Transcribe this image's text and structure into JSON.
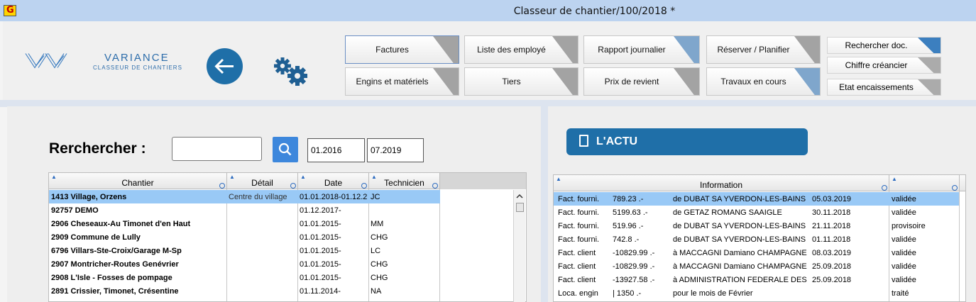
{
  "window": {
    "title": "Classeur de chantier/100/2018 *",
    "app_icon_letter": "G"
  },
  "logo": {
    "name": "VARIANCE",
    "subtitle": "CLASSEUR DE CHANTIERS"
  },
  "nav": {
    "row1": [
      "Factures",
      "Liste des employé",
      "Rapport journalier",
      "Réserver / Planifier"
    ],
    "row2": [
      "Engins et matériels",
      "Tiers",
      "Prix de revient",
      "Travaux en cours"
    ],
    "side": [
      "Rechercher doc.",
      "Chiffre créancier",
      "Etat encaissements"
    ]
  },
  "search": {
    "label": "Rerchercher :",
    "value": "",
    "date_from": "01.2016",
    "date_to": "07.2019"
  },
  "chantier_table": {
    "columns": [
      "Chantier",
      "Détail",
      "Date",
      "Technicien"
    ],
    "rows": [
      [
        "1413 Village, Orzens",
        "Centre du village",
        "01.01.2018-01.12.2",
        "JC"
      ],
      [
        "92757 DEMO",
        "",
        "01.12.2017-",
        ""
      ],
      [
        "2906 Cheseaux-Au Timonet d'en Haut",
        "",
        "01.01.2015-",
        "MM"
      ],
      [
        "2909 Commune de Lully",
        "",
        "01.01.2015-",
        "CHG"
      ],
      [
        "6796 Villars-Ste-Croix/Garage M-Sp",
        "",
        "01.01.2015-",
        "LC"
      ],
      [
        "2907 Montricher-Routes Genévrier",
        "",
        "01.01.2015-",
        "CHG"
      ],
      [
        "2908 L'Isle - Fosses de pompage",
        "",
        "01.01.2015-",
        "CHG"
      ],
      [
        "2891 Crissier, Timonet, Crésentine",
        "",
        "01.11.2014-",
        "NA"
      ]
    ]
  },
  "actu": {
    "title": "L'ACTU"
  },
  "info_table": {
    "columns": [
      "Information",
      ""
    ],
    "rows": [
      {
        "type": "Fact. fourni.",
        "amount": "789.23 .-",
        "desc": "de DUBAT SA YVERDON-LES-BAINS",
        "date": "05.03.2019",
        "status": "validée"
      },
      {
        "type": "Fact. fourni.",
        "amount": "5199.63 .-",
        "desc": "de GETAZ ROMANG SAAIGLE",
        "date": "30.11.2018",
        "status": "validée"
      },
      {
        "type": "Fact. fourni.",
        "amount": "519.96 .-",
        "desc": "de DUBAT SA YVERDON-LES-BAINS",
        "date": "21.11.2018",
        "status": "provisoire"
      },
      {
        "type": "Fact. fourni.",
        "amount": "742.8 .-",
        "desc": "de DUBAT SA YVERDON-LES-BAINS",
        "date": "01.11.2018",
        "status": "validée"
      },
      {
        "type": "Fact. client",
        "amount": "-10829.99 .-",
        "desc": "à  MACCAGNI Damiano CHAMPAGNE",
        "date": "08.03.2019",
        "status": "validée"
      },
      {
        "type": "Fact. client",
        "amount": "-10829.99 .-",
        "desc": "à  MACCAGNI Damiano CHAMPAGNE",
        "date": "25.09.2018",
        "status": "validée"
      },
      {
        "type": "Fact. client",
        "amount": "-13927.58 .-",
        "desc": "à  ADMINISTRATION FEDERALE DES DO",
        "date": "25.09.2018",
        "status": "validée"
      },
      {
        "type": "Loca. engin",
        "amount": "|  1350 .-",
        "desc": "pour le mois de Février",
        "date": "",
        "status": "traité"
      }
    ]
  },
  "colors": {
    "accent": "#1f6fa8",
    "selection": "#99c9f6",
    "titlebar": "#bcd3f0"
  }
}
